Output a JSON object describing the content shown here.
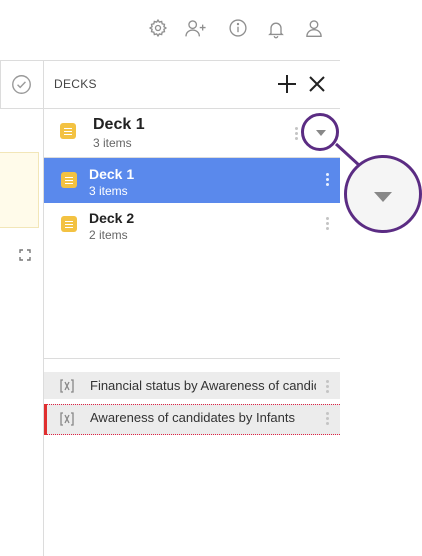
{
  "header": {
    "icons": [
      "gear-icon",
      "add-user-icon",
      "info-icon",
      "bell-icon",
      "user-icon"
    ]
  },
  "decks_panel": {
    "title": "DECKS",
    "current": {
      "name": "Deck 1",
      "count": "3 items"
    },
    "decks": [
      {
        "name": "Deck 1",
        "count": "3 items",
        "selected": true
      },
      {
        "name": "Deck 2",
        "count": "2 items",
        "selected": false
      }
    ]
  },
  "items": [
    {
      "label": "Financial status by Awareness of candidates"
    },
    {
      "label": "Awareness of candidates by Infants"
    }
  ],
  "colors": {
    "accent": "#5a89ec",
    "deck_icon": "#f3c242",
    "highlight_ring": "#5b2c83",
    "active_marker": "#e02f2f"
  }
}
